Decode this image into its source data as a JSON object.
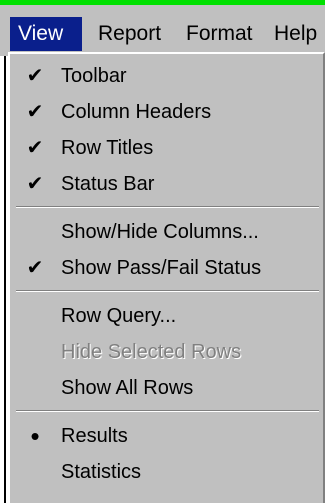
{
  "menubar": {
    "items": [
      {
        "label": "View",
        "active": true
      },
      {
        "label": "Report",
        "active": false
      },
      {
        "label": "Format",
        "active": false
      },
      {
        "label": "Help",
        "active": false
      }
    ]
  },
  "view_menu": {
    "groups": [
      [
        {
          "label": "Toolbar",
          "marker": "✔",
          "enabled": true
        },
        {
          "label": "Column Headers",
          "marker": "✔",
          "enabled": true
        },
        {
          "label": "Row Titles",
          "marker": "✔",
          "enabled": true
        },
        {
          "label": "Status Bar",
          "marker": "✔",
          "enabled": true
        }
      ],
      [
        {
          "label": "Show/Hide Columns...",
          "marker": "",
          "enabled": true
        },
        {
          "label": "Show Pass/Fail Status",
          "marker": "✔",
          "enabled": true
        }
      ],
      [
        {
          "label": "Row Query...",
          "marker": "",
          "enabled": true
        },
        {
          "label": "Hide Selected Rows",
          "marker": "",
          "enabled": false
        },
        {
          "label": "Show All Rows",
          "marker": "",
          "enabled": true
        }
      ],
      [
        {
          "label": "Results",
          "marker": "•",
          "enabled": true
        },
        {
          "label": "Statistics",
          "marker": "",
          "enabled": true
        }
      ]
    ]
  },
  "colors": {
    "menu_face": "#c0c0c0",
    "highlight": "#0a1f8c",
    "highlight_text": "#ffffff",
    "disabled_text": "#808080",
    "top_stripe": "#00e000"
  }
}
